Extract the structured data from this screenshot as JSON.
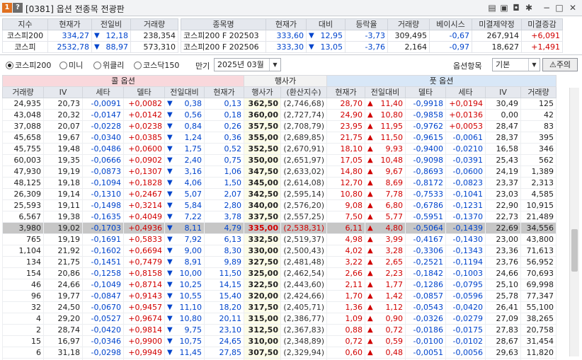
{
  "title": {
    "badge1": "1",
    "badge2": "?",
    "text": "[0381] 옵션 전종목 전광판"
  },
  "titlebar_icons": [
    "layout-icon",
    "copy-icon",
    "camera-icon",
    "settings-icon",
    "minimize-icon",
    "maximize-icon",
    "close-icon"
  ],
  "index": {
    "headers": [
      "지수",
      "현재가",
      "전일비",
      "거래량"
    ],
    "rows": [
      {
        "name": "코스피200",
        "price": "334,27",
        "dir": "up",
        "change": "12,18",
        "volume": "238,354"
      },
      {
        "name": "코스피",
        "price": "2532,78",
        "dir": "down",
        "change": "88,97",
        "volume": "573,310"
      }
    ]
  },
  "futures": {
    "headers": [
      "종목명",
      "현재가",
      "대비",
      "등락율",
      "거래량",
      "베이시스",
      "미결제약정",
      "미결증감"
    ],
    "rows": [
      {
        "name": "코스피200 F 202503",
        "price": "333,60",
        "dir": "down",
        "change": "12,95",
        "rate": "-3,73",
        "volume": "309,495",
        "basis": "-0,67",
        "oi": "267,914",
        "oi_chg": "+6,091"
      },
      {
        "name": "코스피200 F 202506",
        "price": "333,30",
        "dir": "down",
        "change": "13,05",
        "rate": "-3,76",
        "volume": "2,164",
        "basis": "-0,97",
        "oi": "18,627",
        "oi_chg": "+1,491"
      }
    ]
  },
  "filters": {
    "radios": [
      {
        "label": "코스피200",
        "selected": true
      },
      {
        "label": "미니",
        "selected": false
      },
      {
        "label": "위클리",
        "selected": false
      },
      {
        "label": "코스닥150",
        "selected": false
      }
    ],
    "expiry_label": "만기",
    "expiry_value": "2025년 03월",
    "item_label": "옵션항목",
    "item_value": "기본",
    "warning_label": "주의"
  },
  "options": {
    "sections": {
      "call": "콜 옵션",
      "strike": "행사가",
      "put": "풋 옵션"
    },
    "headers": [
      "거래량",
      "IV",
      "세타",
      "델타",
      "전일대비",
      "현재가",
      "행사가",
      "(환산지수)",
      "현재가",
      "전일대비",
      "델타",
      "세타",
      "IV",
      "거래량"
    ],
    "rows": [
      [
        "24,935",
        "20,73",
        "-0,0091",
        "+0,0082",
        "down",
        "0,38",
        "0,13",
        "362,50",
        "(2,746,68)",
        "28,70",
        "up",
        "11,40",
        "-0,9918",
        "+0,0194",
        "30,49",
        "125"
      ],
      [
        "43,048",
        "20,32",
        "-0,0147",
        "+0,0142",
        "down",
        "0,56",
        "0,18",
        "360,00",
        "(2,727,74)",
        "24,90",
        "up",
        "10,80",
        "-0,9858",
        "+0,0136",
        "0,00",
        "42"
      ],
      [
        "37,088",
        "20,07",
        "-0,0228",
        "+0,0238",
        "down",
        "0,84",
        "0,26",
        "357,50",
        "(2,708,79)",
        "23,95",
        "up",
        "11,95",
        "-0,9762",
        "+0,0053",
        "28,47",
        "83"
      ],
      [
        "45,658",
        "19,67",
        "-0,0340",
        "+0,0385",
        "down",
        "1,24",
        "0,36",
        "355,00",
        "(2,689,85)",
        "21,75",
        "up",
        "11,50",
        "-0,9615",
        "-0,0061",
        "28,37",
        "395"
      ],
      [
        "45,755",
        "19,48",
        "-0,0486",
        "+0,0600",
        "down",
        "1,75",
        "0,52",
        "352,50",
        "(2,670,91)",
        "18,10",
        "up",
        "9,93",
        "-0,9400",
        "-0,0210",
        "16,58",
        "346"
      ],
      [
        "60,003",
        "19,35",
        "-0,0666",
        "+0,0902",
        "down",
        "2,40",
        "0,75",
        "350,00",
        "(2,651,97)",
        "17,05",
        "up",
        "10,48",
        "-0,9098",
        "-0,0391",
        "25,43",
        "562"
      ],
      [
        "47,930",
        "19,19",
        "-0,0873",
        "+0,1307",
        "down",
        "3,16",
        "1,06",
        "347,50",
        "(2,633,02)",
        "14,80",
        "up",
        "9,67",
        "-0,8693",
        "-0,0600",
        "24,19",
        "1,389"
      ],
      [
        "48,125",
        "19,18",
        "-0,1094",
        "+0,1828",
        "down",
        "4,06",
        "1,50",
        "345,00",
        "(2,614,08)",
        "12,70",
        "up",
        "8,69",
        "-0,8172",
        "-0,0823",
        "23,37",
        "2,313"
      ],
      [
        "26,309",
        "19,14",
        "-0,1310",
        "+0,2467",
        "down",
        "5,07",
        "2,07",
        "342,50",
        "(2,595,14)",
        "10,80",
        "up",
        "7,78",
        "-0,7533",
        "-0,1041",
        "23,03",
        "4,585"
      ],
      [
        "25,593",
        "19,11",
        "-0,1498",
        "+0,3214",
        "down",
        "5,84",
        "2,80",
        "340,00",
        "(2,576,20)",
        "9,08",
        "up",
        "6,80",
        "-0,6786",
        "-0,1231",
        "22,90",
        "10,915"
      ],
      [
        "6,567",
        "19,38",
        "-0,1635",
        "+0,4049",
        "down",
        "7,22",
        "3,78",
        "337,50",
        "(2,557,25)",
        "7,50",
        "up",
        "5,77",
        "-0,5951",
        "-0,1370",
        "22,73",
        "21,489"
      ],
      [
        "3,980",
        "19,02",
        "-0,1703",
        "+0,4936",
        "down",
        "8,11",
        "4,79",
        "335,00",
        "(2,538,31)",
        "6,11",
        "up",
        "4,80",
        "-0,5064",
        "-0,1439",
        "22,69",
        "34,556"
      ],
      [
        "765",
        "19,19",
        "-0,1691",
        "+0,5833",
        "down",
        "7,92",
        "6,13",
        "332,50",
        "(2,519,37)",
        "4,98",
        "up",
        "3,99",
        "-0,4167",
        "-0,1430",
        "23,00",
        "43,800"
      ],
      [
        "1,104",
        "21,92",
        "-0,1602",
        "+0,6694",
        "down",
        "9,00",
        "8,30",
        "330,00",
        "(2,500,43)",
        "4,02",
        "up",
        "3,28",
        "-0,3306",
        "-0,1343",
        "23,36",
        "71,613"
      ],
      [
        "134",
        "21,75",
        "-0,1451",
        "+0,7479",
        "down",
        "8,91",
        "9,89",
        "327,50",
        "(2,481,48)",
        "3,22",
        "up",
        "2,65",
        "-0,2521",
        "-0,1194",
        "23,76",
        "56,952"
      ],
      [
        "154",
        "20,86",
        "-0,1258",
        "+0,8158",
        "down",
        "10,00",
        "11,50",
        "325,00",
        "(2,462,54)",
        "2,66",
        "up",
        "2,23",
        "-0,1842",
        "-0,1003",
        "24,66",
        "70,693"
      ],
      [
        "46",
        "24,66",
        "-0,1049",
        "+0,8714",
        "down",
        "10,25",
        "14,15",
        "322,50",
        "(2,443,60)",
        "2,11",
        "up",
        "1,77",
        "-0,1286",
        "-0,0795",
        "25,10",
        "69,998"
      ],
      [
        "96",
        "19,77",
        "-0,0847",
        "+0,9143",
        "down",
        "10,55",
        "15,40",
        "320,00",
        "(2,424,66)",
        "1,70",
        "up",
        "1,42",
        "-0,0857",
        "-0,0596",
        "25,78",
        "77,347"
      ],
      [
        "32",
        "24,50",
        "-0,0670",
        "+0,9457",
        "down",
        "11,10",
        "18,20",
        "317,50",
        "(2,405,71)",
        "1,36",
        "up",
        "1,12",
        "-0,0543",
        "-0,0420",
        "26,41",
        "55,100"
      ],
      [
        "4",
        "29,20",
        "-0,0527",
        "+0,9674",
        "down",
        "10,80",
        "20,11",
        "315,00",
        "(2,386,77)",
        "1,09",
        "up",
        "0,90",
        "-0,0326",
        "-0,0279",
        "27,09",
        "38,265"
      ],
      [
        "2",
        "28,74",
        "-0,0420",
        "+0,9814",
        "down",
        "9,75",
        "23,10",
        "312,50",
        "(2,367,83)",
        "0,88",
        "up",
        "0,72",
        "-0,0186",
        "-0,0175",
        "27,83",
        "20,758"
      ],
      [
        "15",
        "16,97",
        "-0,0346",
        "+0,9900",
        "down",
        "10,75",
        "24,65",
        "310,00",
        "(2,348,89)",
        "0,72",
        "up",
        "0,59",
        "-0,0100",
        "-0,0102",
        "28,67",
        "31,454"
      ],
      [
        "6",
        "31,18",
        "-0,0298",
        "+0,9949",
        "down",
        "11,45",
        "27,85",
        "307,50",
        "(2,329,94)",
        "0,60",
        "up",
        "0,48",
        "-0,0051",
        "-0,0056",
        "29,63",
        "11,820"
      ],
      [
        "0",
        "97,04",
        "-0,0269",
        "+0,9976",
        "none",
        "0,00",
        "41,80",
        "305,00",
        "(2,311,00)",
        "0,50",
        "up",
        "0,40",
        "-0,0024",
        "-0,0029",
        "30,57",
        "18,079"
      ]
    ],
    "atm_row_index": 11
  }
}
